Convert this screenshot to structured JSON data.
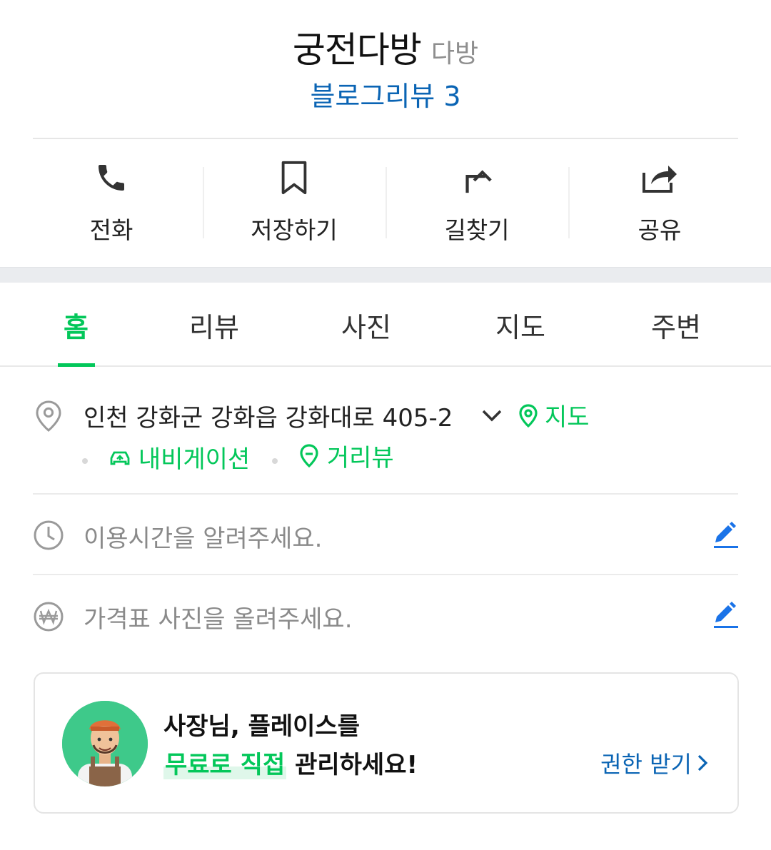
{
  "header": {
    "place_name": "궁전다방",
    "category": "다방",
    "blog_review": "블로그리뷰 3"
  },
  "actions": [
    {
      "label": "전화",
      "icon": "phone-icon"
    },
    {
      "label": "저장하기",
      "icon": "bookmark-icon"
    },
    {
      "label": "길찾기",
      "icon": "directions-icon"
    },
    {
      "label": "공유",
      "icon": "share-icon"
    }
  ],
  "tabs": [
    {
      "label": "홈",
      "active": true
    },
    {
      "label": "리뷰"
    },
    {
      "label": "사진"
    },
    {
      "label": "지도"
    },
    {
      "label": "주변"
    }
  ],
  "info": {
    "address": "인천 강화군 강화읍 강화대로 405-2",
    "map_link": "지도",
    "navigation_link": "내비게이션",
    "street_view_link": "거리뷰",
    "hours_hint": "이용시간을 알려주세요.",
    "price_hint": "가격표 사진을 올려주세요."
  },
  "banner": {
    "line1": "사장님, 플레이스를",
    "highlight": "무료로 직접",
    "line2_rest": " 관리하세요!",
    "permission_link": "권한 받기"
  },
  "colors": {
    "accent_green": "#03c75a",
    "link_blue": "#0a64b4",
    "edit_blue": "#1a73e8"
  }
}
